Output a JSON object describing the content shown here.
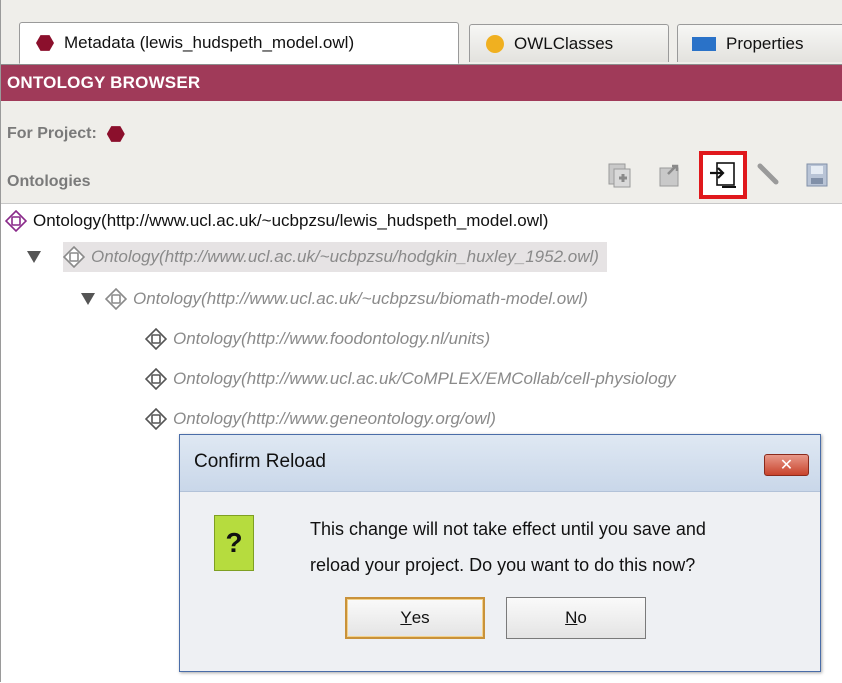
{
  "tabs": [
    {
      "label": "Metadata (lewis_hudspeth_model.owl)",
      "icon": "ontology-hexagon-icon",
      "active": true
    },
    {
      "label": "OWLClasses",
      "icon": "owl-class-circle-icon",
      "active": false
    },
    {
      "label": "Properties",
      "icon": "properties-rect-icon",
      "active": false
    }
  ],
  "header": {
    "title": "ONTOLOGY BROWSER"
  },
  "project": {
    "label": "For Project:"
  },
  "ontologies": {
    "label": "Ontologies"
  },
  "toolbar_icons": [
    "add-ontology-icon",
    "import-ontology-icon",
    "reload-import-icon",
    "edit-icon",
    "save-icon"
  ],
  "tree": [
    {
      "label": "Ontology(http://www.ucl.ac.uk/~ucbpzsu/lewis_hudspeth_model.owl)"
    },
    {
      "label": "Ontology(http://www.ucl.ac.uk/~ucbpzsu/hodgkin_huxley_1952.owl)"
    },
    {
      "label": "Ontology(http://www.ucl.ac.uk/~ucbpzsu/biomath-model.owl)"
    },
    {
      "label": "Ontology(http://www.foodontology.nl/units)"
    },
    {
      "label": "Ontology(http://www.ucl.ac.uk/CoMPLEX/EMCollab/cell-physiology"
    },
    {
      "label": "Ontology(http://www.geneontology.org/owl)"
    }
  ],
  "dialog": {
    "title": "Confirm Reload",
    "close_glyph": "✕",
    "question_glyph": "?",
    "message_line1": "This change will not take effect until you save and",
    "message_line2": "reload your project.  Do you want to do this now?",
    "yes_mnemonic": "Y",
    "yes_rest": "es",
    "no_mnemonic": "N",
    "no_rest": "o"
  },
  "colors": {
    "header": "#a03a59",
    "ontology": "#8b0f2c",
    "highlight": "#e0181c",
    "question": "#b6dc3e"
  }
}
